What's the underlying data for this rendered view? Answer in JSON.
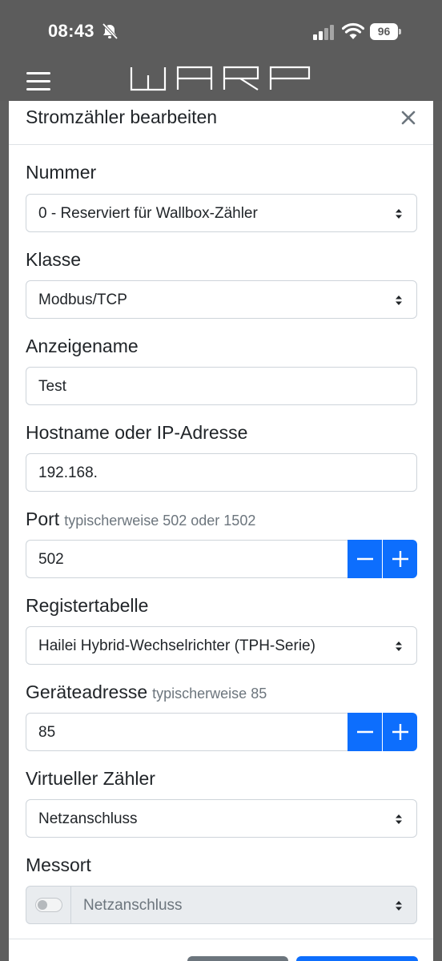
{
  "status_bar": {
    "time": "08:43",
    "battery": "96",
    "icons": [
      "bell-slash-icon",
      "signal-icon",
      "wifi-icon",
      "battery-icon"
    ]
  },
  "nav": {
    "menu_icon": "hamburger-icon",
    "logo_text": "WARP"
  },
  "modal": {
    "title": "Stromzähler bearbeiten",
    "close_icon": "close-icon",
    "fields": {
      "nummer": {
        "label": "Nummer",
        "value": "0 - Reserviert für Wallbox-Zähler"
      },
      "klasse": {
        "label": "Klasse",
        "value": "Modbus/TCP"
      },
      "anzeigename": {
        "label": "Anzeigename",
        "value": "Test"
      },
      "hostname": {
        "label": "Hostname oder IP-Adresse",
        "value": "192.168."
      },
      "port": {
        "label": "Port",
        "hint": "typischerweise 502 oder 1502",
        "value": "502"
      },
      "registertabelle": {
        "label": "Registertabelle",
        "value": "Hailei Hybrid-Wechselrichter (TPH-Serie)"
      },
      "geraeteadresse": {
        "label": "Geräteadresse",
        "hint": "typischerweise 85",
        "value": "85"
      },
      "virtueller_zaehler": {
        "label": "Virtueller Zähler",
        "value": "Netzanschluss"
      },
      "messort": {
        "label": "Messort",
        "value": "Netzanschluss",
        "enabled": false
      }
    }
  },
  "colors": {
    "primary": "#0d6efd",
    "secondary": "#6c757d",
    "header_bg": "#5c5c5c"
  }
}
